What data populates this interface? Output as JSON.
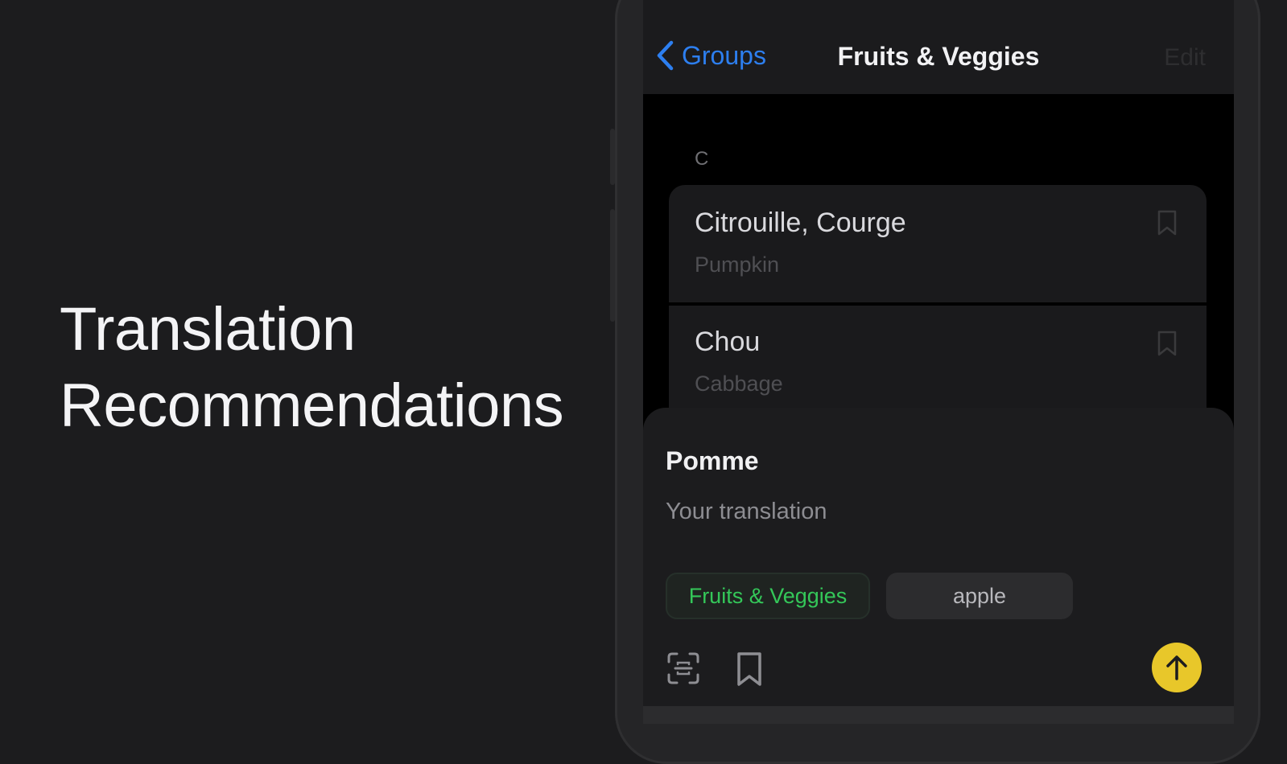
{
  "headline": {
    "line1": "Translation",
    "line2": "Recommendations"
  },
  "navbar": {
    "back_label": "Groups",
    "title": "Fruits & Veggies",
    "edit_label": "Edit"
  },
  "list": {
    "section": "C",
    "items": [
      {
        "word": "Citrouille, Courge",
        "translation": "Pumpkin"
      },
      {
        "word": "Chou",
        "translation": "Cabbage"
      }
    ]
  },
  "sheet": {
    "source_word": "Pomme",
    "input_placeholder": "Your translation",
    "group_chip": "Fruits & Veggies",
    "suggestion_chip": "apple"
  },
  "colors": {
    "accent_blue": "#2d7ff0",
    "group_green": "#34c759",
    "send_yellow": "#e8c72a"
  },
  "icons": [
    "chevron-left-icon",
    "bookmark-icon",
    "scan-text-icon",
    "arrow-up-icon"
  ]
}
